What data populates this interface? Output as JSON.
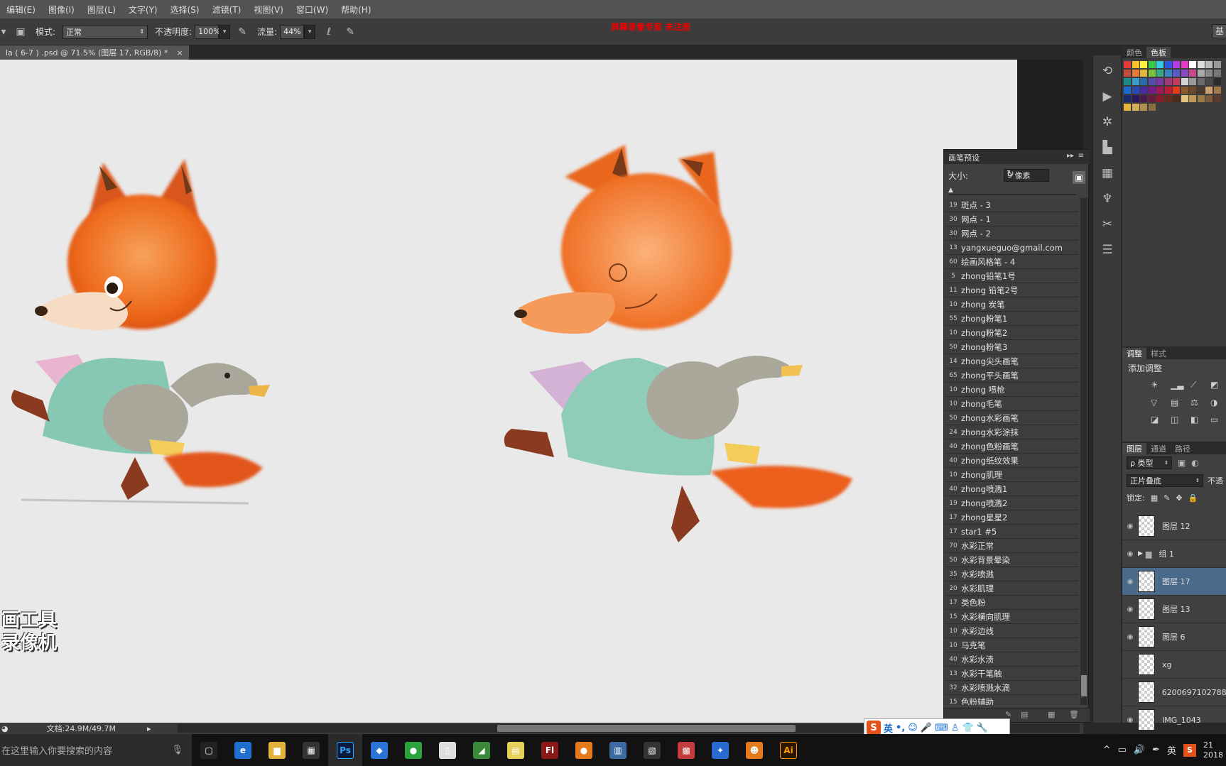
{
  "menubar": {
    "items": [
      "编辑(E)",
      "图像(I)",
      "图层(L)",
      "文字(Y)",
      "选择(S)",
      "滤镜(T)",
      "视图(V)",
      "窗口(W)",
      "帮助(H)"
    ]
  },
  "options": {
    "mode_label": "模式:",
    "mode_value": "正常",
    "opacity_label": "不透明度:",
    "opacity_value": "100%",
    "flow_label": "流量:",
    "flow_value": "44%",
    "workspace_button": "基"
  },
  "watermark": "屏幕录像专家  未注册",
  "document_tab": {
    "title": "la ( 6-7 ) .psd @ 71.5% (图层 17, RGB/8) *",
    "close": "×"
  },
  "recorder_logo": "画工具\n录像机",
  "status": {
    "doc_info": "文档:24.9M/49.7M"
  },
  "brush_panel": {
    "title": "画笔预设",
    "size_label": "大小:",
    "size_value": "9 像素",
    "brushes": [
      {
        "num": "19",
        "name": "斑点 - 3"
      },
      {
        "num": "30",
        "name": "网点 - 1"
      },
      {
        "num": "30",
        "name": "网点 - 2"
      },
      {
        "num": "13",
        "name": "yangxueguo@gmail.com"
      },
      {
        "num": "60",
        "name": "绘画风格笔 - 4"
      },
      {
        "num": "5",
        "name": "zhong铅笔1号"
      },
      {
        "num": "11",
        "name": "zhong 铅笔2号"
      },
      {
        "num": "10",
        "name": "zhong 炭笔"
      },
      {
        "num": "55",
        "name": "zhong粉笔1"
      },
      {
        "num": "10",
        "name": "zhong粉笔2"
      },
      {
        "num": "50",
        "name": "zhong粉笔3"
      },
      {
        "num": "14",
        "name": "zhong尖头画笔"
      },
      {
        "num": "65",
        "name": "zhong平头画笔"
      },
      {
        "num": "10",
        "name": "zhong 喷枪"
      },
      {
        "num": "10",
        "name": "zhong毛笔"
      },
      {
        "num": "50",
        "name": "zhong水彩画笔"
      },
      {
        "num": "24",
        "name": "zhong水彩涂抹"
      },
      {
        "num": "40",
        "name": "zhong色粉画笔"
      },
      {
        "num": "40",
        "name": "zhong纸纹效果"
      },
      {
        "num": "10",
        "name": "zhong肌理"
      },
      {
        "num": "40",
        "name": "zhong喷溅1"
      },
      {
        "num": "19",
        "name": "zhong喷溅2"
      },
      {
        "num": "17",
        "name": "zhong星星2"
      },
      {
        "num": "17",
        "name": "star1 #5"
      },
      {
        "num": "70",
        "name": "水彩正常"
      },
      {
        "num": "50",
        "name": "水彩背景晕染"
      },
      {
        "num": "35",
        "name": "水彩喷溅"
      },
      {
        "num": "20",
        "name": "水彩肌理"
      },
      {
        "num": "17",
        "name": "类色粉"
      },
      {
        "num": "15",
        "name": "水彩横向肌理"
      },
      {
        "num": "10",
        "name": "水彩边线"
      },
      {
        "num": "10",
        "name": "马克笔"
      },
      {
        "num": "40",
        "name": "水彩水渍"
      },
      {
        "num": "13",
        "name": "水彩干笔触"
      },
      {
        "num": "32",
        "name": "水彩喷溅水滴"
      },
      {
        "num": "15",
        "name": "色粉辅助"
      }
    ]
  },
  "panels": {
    "color_tabs": [
      "颜色",
      "色板"
    ],
    "adjust_tabs": [
      "调整",
      "样式"
    ],
    "adjust_title": "添加调整",
    "layer_tabs": [
      "图层",
      "通道",
      "路径"
    ],
    "filter_label": "ρ 类型",
    "blend_mode": "正片叠底",
    "opacity_short": "不透",
    "lock_label": "锁定:"
  },
  "layers": [
    {
      "name": "图层 12",
      "visible": true,
      "selected": false,
      "type": "layer"
    },
    {
      "name": "组 1",
      "visible": true,
      "selected": false,
      "type": "group"
    },
    {
      "name": "图层 17",
      "visible": true,
      "selected": true,
      "type": "layer"
    },
    {
      "name": "图层 13",
      "visible": true,
      "selected": false,
      "type": "layer"
    },
    {
      "name": "图层 6",
      "visible": true,
      "selected": false,
      "type": "layer"
    },
    {
      "name": "xg",
      "visible": false,
      "selected": false,
      "type": "layer"
    },
    {
      "name": "6200697102788",
      "visible": false,
      "selected": false,
      "type": "layer"
    },
    {
      "name": "IMG_1043",
      "visible": true,
      "selected": false,
      "type": "layer"
    }
  ],
  "taskbar": {
    "search_placeholder": "在这里输入你要搜索的内容",
    "apps": [
      {
        "icon": "task-view-icon",
        "label": "▢",
        "color": "#222"
      },
      {
        "icon": "edge-icon",
        "label": "e",
        "color": "#1e6fd0"
      },
      {
        "icon": "folder-icon",
        "label": "▆",
        "color": "#e0b33a"
      },
      {
        "icon": "store-icon",
        "label": "▦",
        "color": "#333"
      },
      {
        "icon": "photoshop-icon",
        "label": "Ps",
        "color": "#0d1b3a"
      },
      {
        "icon": "app-blue-icon",
        "label": "◆",
        "color": "#2a74d6"
      },
      {
        "icon": "app-green-icon",
        "label": "●",
        "color": "#2aa33c"
      },
      {
        "icon": "file-icon",
        "label": "▯",
        "color": "#ddd"
      },
      {
        "icon": "app-map-icon",
        "label": "◢",
        "color": "#3a8a3a"
      },
      {
        "icon": "notes-icon",
        "label": "▤",
        "color": "#e5d05a"
      },
      {
        "icon": "flash-icon",
        "label": "Fl",
        "color": "#8a1a1a"
      },
      {
        "icon": "app-orange-icon",
        "label": "●",
        "color": "#e57a1a"
      },
      {
        "icon": "screenshot-icon",
        "label": "▥",
        "color": "#3a6aa0"
      },
      {
        "icon": "film-icon",
        "label": "▧",
        "color": "#333"
      },
      {
        "icon": "app-red-icon",
        "label": "▩",
        "color": "#c53a3a"
      },
      {
        "icon": "bird-icon",
        "label": "✦",
        "color": "#2a6ad0"
      },
      {
        "icon": "smile-icon",
        "label": "☻",
        "color": "#e57a1a"
      },
      {
        "icon": "illustrator-icon",
        "label": "Ai",
        "color": "#2b1600"
      }
    ],
    "ime": "英",
    "time": "21",
    "date": "2018"
  },
  "ime_bar": {
    "lang": "英"
  },
  "colors": {
    "accent": "#4a6a8c",
    "watermark": "#f20000",
    "canvas": "#e9e9ea"
  }
}
